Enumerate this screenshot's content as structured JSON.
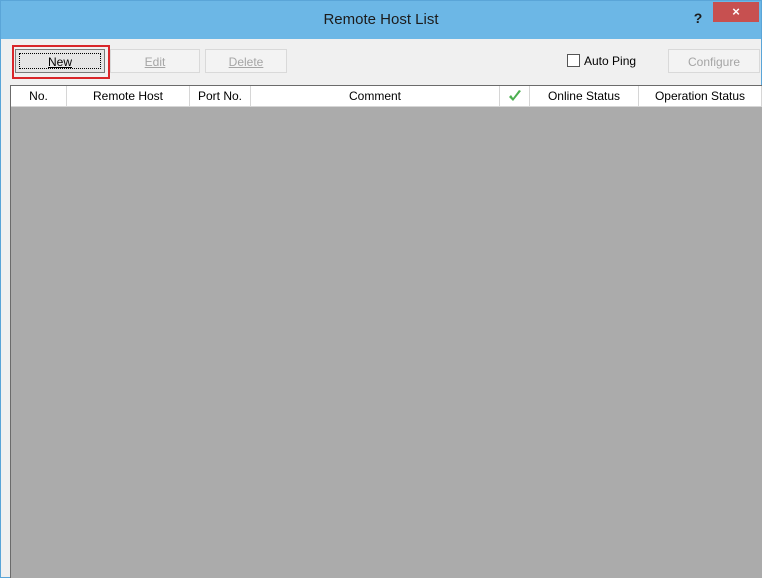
{
  "window": {
    "title": "Remote Host List",
    "help_label": "?",
    "close_label": "×"
  },
  "toolbar": {
    "new_label": "New",
    "edit_label": "Edit",
    "delete_label": "Delete",
    "auto_ping_label": "Auto Ping",
    "auto_ping_checked": false,
    "configure_label": "Configure"
  },
  "table": {
    "columns": [
      "No.",
      "Remote Host",
      "Port No.",
      "Comment",
      "check-icon",
      "Online Status",
      "Operation Status"
    ],
    "rows": []
  },
  "colors": {
    "titlebar": "#6cb7e6",
    "close_button": "#c75050",
    "highlight_box": "#d9262a",
    "grid_background": "#ababab",
    "check_icon": "#4caf50"
  }
}
